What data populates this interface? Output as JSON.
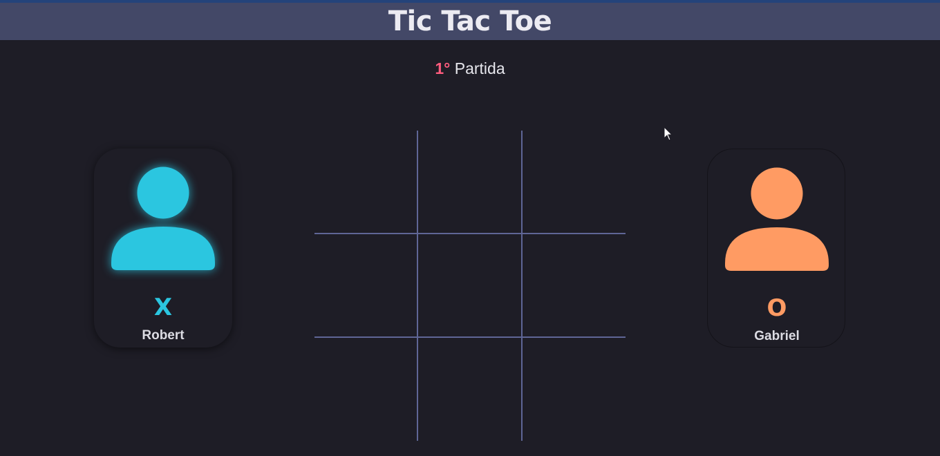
{
  "header": {
    "title": "Tic Tac Toe"
  },
  "round": {
    "number": "1°",
    "label": "Partida"
  },
  "players": {
    "left": {
      "symbol": "X",
      "name": "Robert",
      "color": "#2bc6e0",
      "icon": "user-icon"
    },
    "right": {
      "symbol": "O",
      "name": "Gabriel",
      "color": "#ff9b63",
      "icon": "user-icon"
    }
  },
  "board": {
    "rows": 3,
    "cols": 3,
    "cells": [
      "",
      "",
      "",
      "",
      "",
      "",
      "",
      "",
      ""
    ],
    "line_color": "#5f6696"
  },
  "colors": {
    "background": "#1e1d26",
    "header": "#434867",
    "accent": "#ff5c7e"
  }
}
